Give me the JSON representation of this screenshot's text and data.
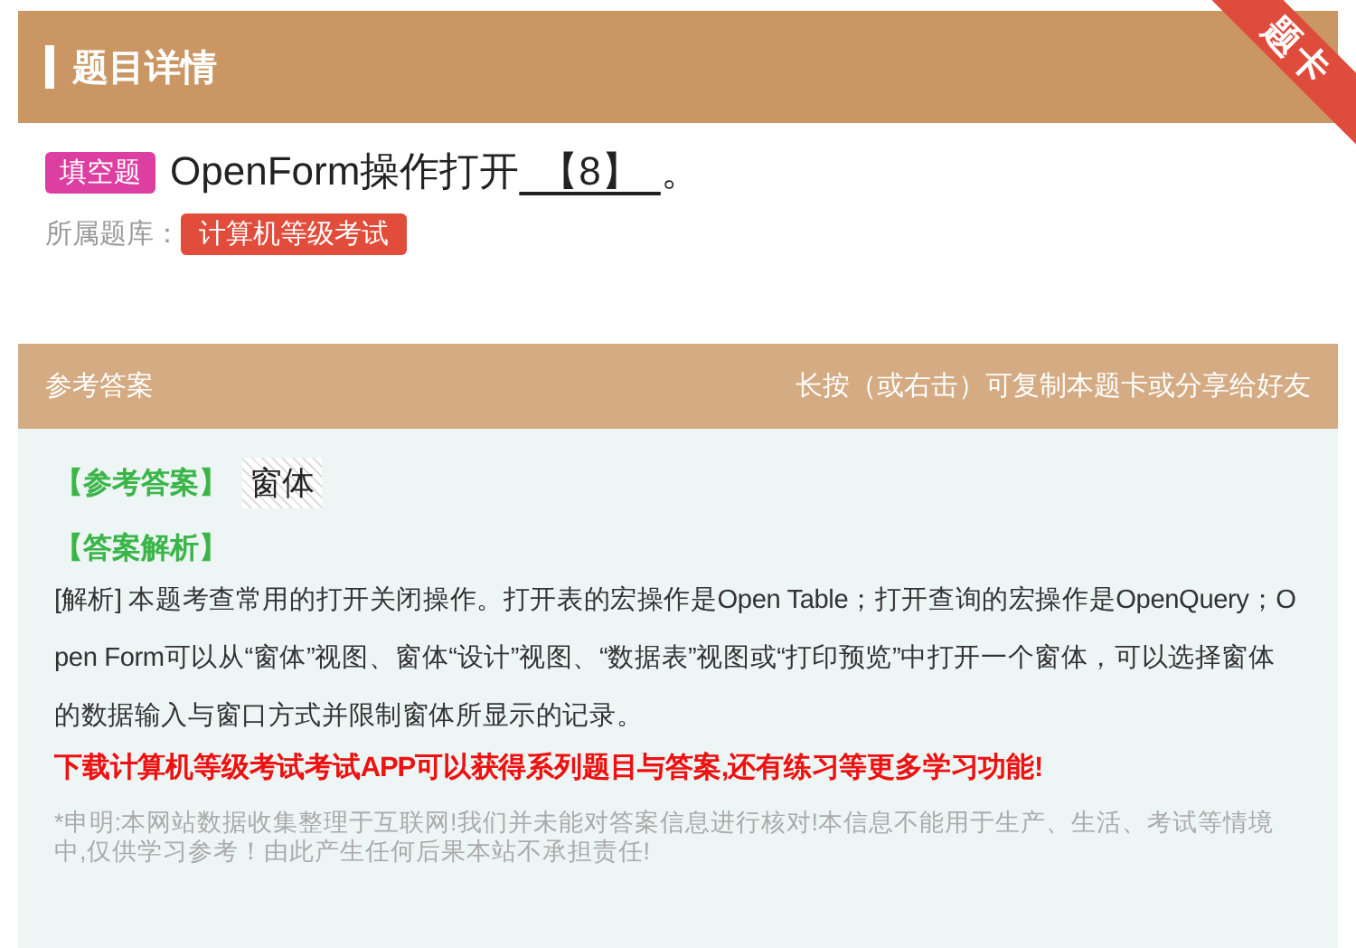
{
  "header": {
    "title": "题目详情",
    "ribbon": "题卡"
  },
  "question": {
    "type_tag": "填空题",
    "text": "OpenForm操作打开",
    "blank": "【8】",
    "end": "。",
    "bank_label": "所属题库：",
    "bank": "计算机等级考试"
  },
  "answer_bar": {
    "title": "参考答案",
    "hint": "长按（或右击）可复制本题卡或分享给好友"
  },
  "answer": {
    "answer_label": "【参考答案】",
    "answer_value": "窗体",
    "analysis_label": "【答案解析】",
    "analysis": "[解析] 本题考查常用的打开关闭操作。打开表的宏操作是Open Table；打开查询的宏操作是OpenQuery；Open Form可以从“窗体”视图、窗体“设计”视图、“数据表”视图或“打印预览”中打开一个窗体，可以选择窗体的数据输入与窗口方式并限制窗体所显示的记录。",
    "promo": "下载计算机等级考试考试APP可以获得系列题目与答案,还有练习等更多学习功能!",
    "disclaimer": "*申明:本网站数据收集整理于互联网!我们并未能对答案信息进行核对!本信息不能用于生产、生活、考试等情境中,仅供学习参考！由此产生任何后果本站不承担责任!"
  }
}
